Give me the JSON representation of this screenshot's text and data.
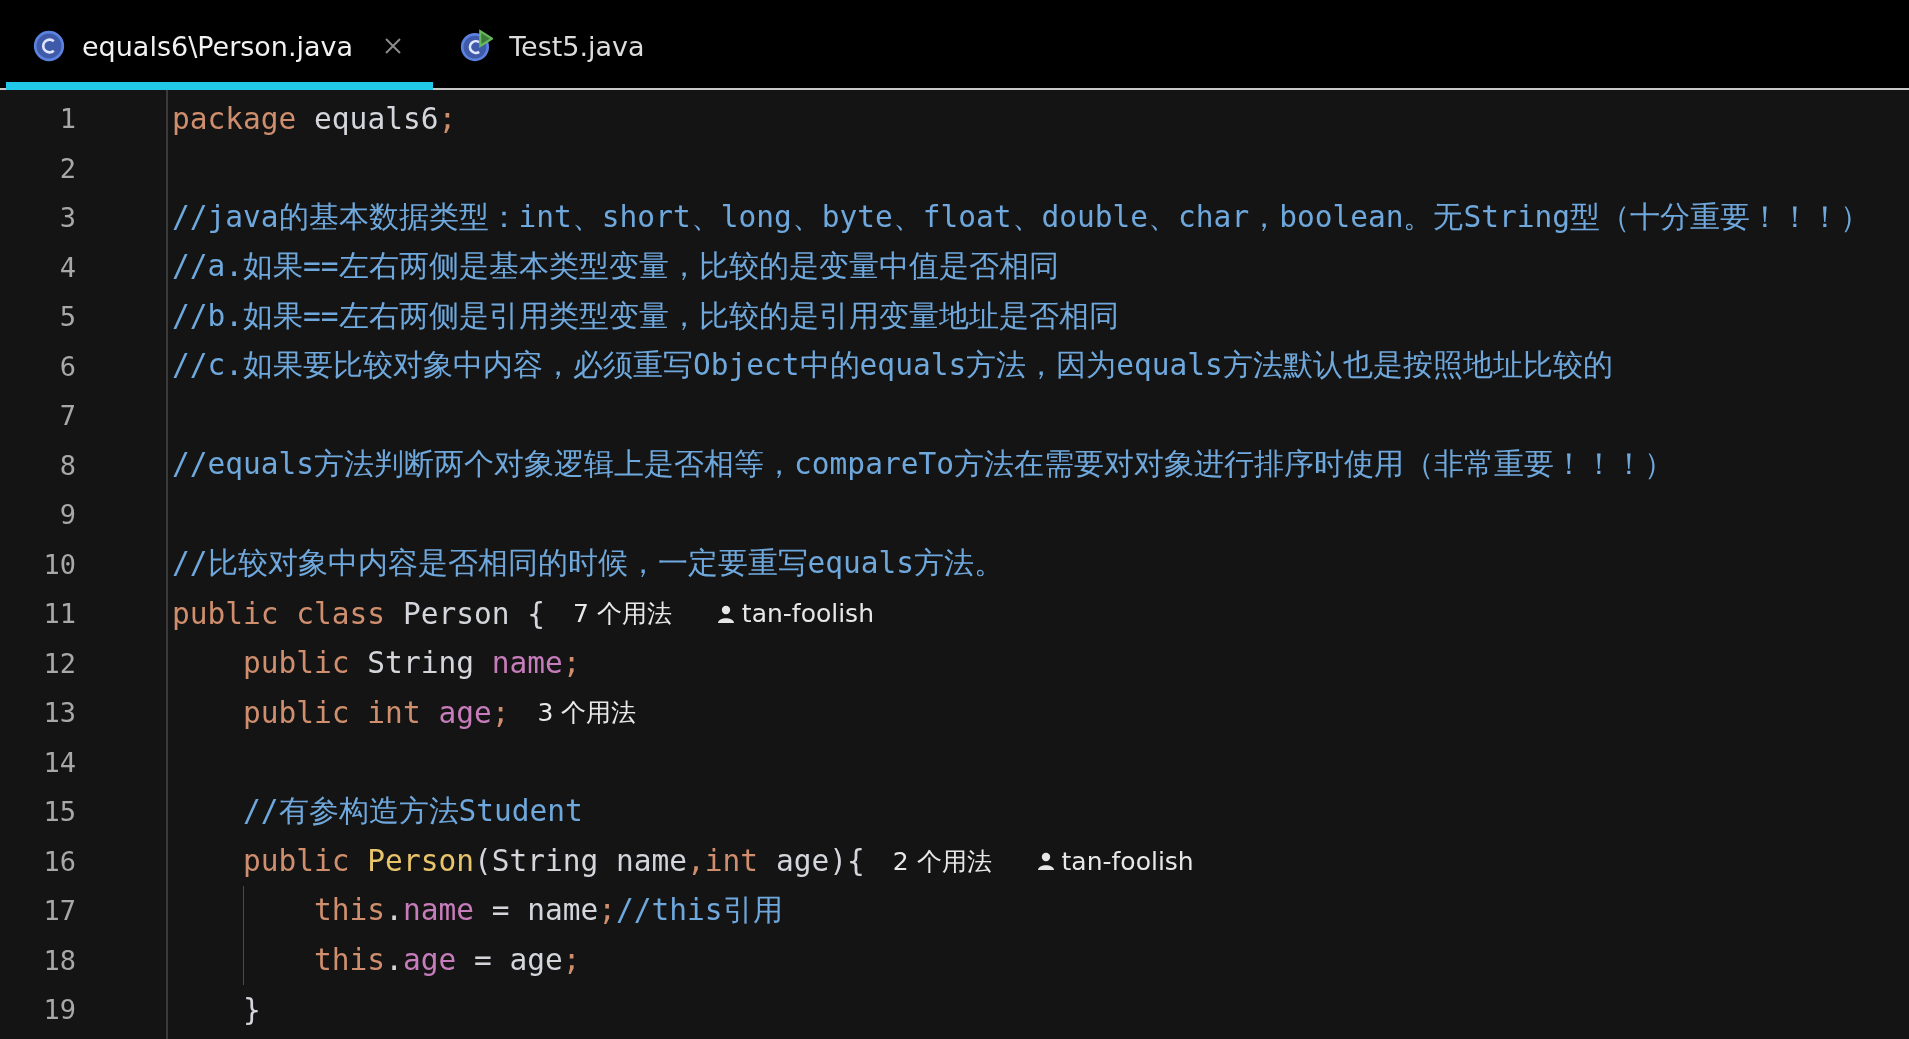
{
  "tabs": [
    {
      "label": "equals6\\Person.java",
      "kind": "class",
      "selected": true
    },
    {
      "label": "Test5.java",
      "kind": "runnable",
      "selected": false
    }
  ],
  "lines": [
    {
      "number": "1",
      "tokens": [
        {
          "text": "package ",
          "kind": "keyword"
        },
        {
          "text": "equals6",
          "kind": "plain"
        },
        {
          "text": ";",
          "kind": "keyword"
        }
      ]
    },
    {
      "number": "2"
    },
    {
      "number": "3",
      "tokens": [
        {
          "text": "//java的基本数据类型：int、short、long、byte、float、double、char，boolean。无String型（十分重要！！！）",
          "kind": "comment"
        }
      ]
    },
    {
      "number": "4",
      "tokens": [
        {
          "text": "//a.如果==左右两侧是基本类型变量，比较的是变量中值是否相同",
          "kind": "comment"
        }
      ]
    },
    {
      "number": "5",
      "tokens": [
        {
          "text": "//b.如果==左右两侧是引用类型变量，比较的是引用变量地址是否相同",
          "kind": "comment"
        }
      ]
    },
    {
      "number": "6",
      "tokens": [
        {
          "text": "//c.如果要比较对象中内容，必须重写Object中的equals方法，因为equals方法默认也是按照地址比较的",
          "kind": "comment"
        }
      ]
    },
    {
      "number": "7"
    },
    {
      "number": "8",
      "tokens": [
        {
          "text": "//equals方法判断两个对象逻辑上是否相等，compareTo方法在需要对对象进行排序时使用（非常重要！！！）",
          "kind": "comment"
        }
      ]
    },
    {
      "number": "9"
    },
    {
      "number": "10",
      "tokens": [
        {
          "text": "//比较对象中内容是否相同的时候，一定要重写equals方法。",
          "kind": "comment"
        }
      ]
    },
    {
      "number": "11",
      "tokens": [
        {
          "text": "public class ",
          "kind": "keyword"
        },
        {
          "text": "Person {",
          "kind": "plain"
        }
      ],
      "hints": [
        {
          "kind": "usages",
          "text": "7 个用法"
        },
        {
          "kind": "author",
          "text": "tan-foolish"
        }
      ],
      "children": [
        {
          "number": "12",
          "tokens": [
            {
              "text": "public ",
              "kind": "keyword"
            },
            {
              "text": "String ",
              "kind": "plain"
            },
            {
              "text": "name",
              "kind": "field"
            },
            {
              "text": ";",
              "kind": "keyword"
            }
          ]
        },
        {
          "number": "13",
          "tokens": [
            {
              "text": "public int ",
              "kind": "keyword"
            },
            {
              "text": "age",
              "kind": "field"
            },
            {
              "text": ";",
              "kind": "keyword"
            }
          ],
          "hints": [
            {
              "kind": "usages",
              "text": "3 个用法"
            }
          ]
        },
        {
          "number": "14"
        },
        {
          "number": "15",
          "tokens": [
            {
              "text": "//有参构造方法Student",
              "kind": "comment"
            }
          ]
        },
        {
          "number": "16",
          "tokens": [
            {
              "text": "public ",
              "kind": "keyword"
            },
            {
              "text": "Person",
              "kind": "declaration"
            },
            {
              "text": "(String name",
              "kind": "plain"
            },
            {
              "text": ",int ",
              "kind": "keyword"
            },
            {
              "text": "age){",
              "kind": "plain"
            }
          ],
          "hints": [
            {
              "kind": "usages",
              "text": "2 个用法"
            },
            {
              "kind": "author",
              "text": "tan-foolish"
            }
          ],
          "children": [
            {
              "number": "17",
              "tokens": [
                {
                  "text": "this",
                  "kind": "keyword"
                },
                {
                  "text": ".",
                  "kind": "plain"
                },
                {
                  "text": "name",
                  "kind": "field"
                },
                {
                  "text": " = name",
                  "kind": "plain"
                },
                {
                  "text": ";",
                  "kind": "keyword"
                },
                {
                  "text": "//this引用",
                  "kind": "comment"
                }
              ]
            },
            {
              "number": "18",
              "tokens": [
                {
                  "text": "this",
                  "kind": "keyword"
                },
                {
                  "text": ".",
                  "kind": "plain"
                },
                {
                  "text": "age",
                  "kind": "field"
                },
                {
                  "text": " = age",
                  "kind": "plain"
                },
                {
                  "text": ";",
                  "kind": "keyword"
                }
              ]
            }
          ]
        },
        {
          "number": "19",
          "tokens": [
            {
              "text": "}",
              "kind": "plain"
            }
          ]
        }
      ]
    }
  ]
}
